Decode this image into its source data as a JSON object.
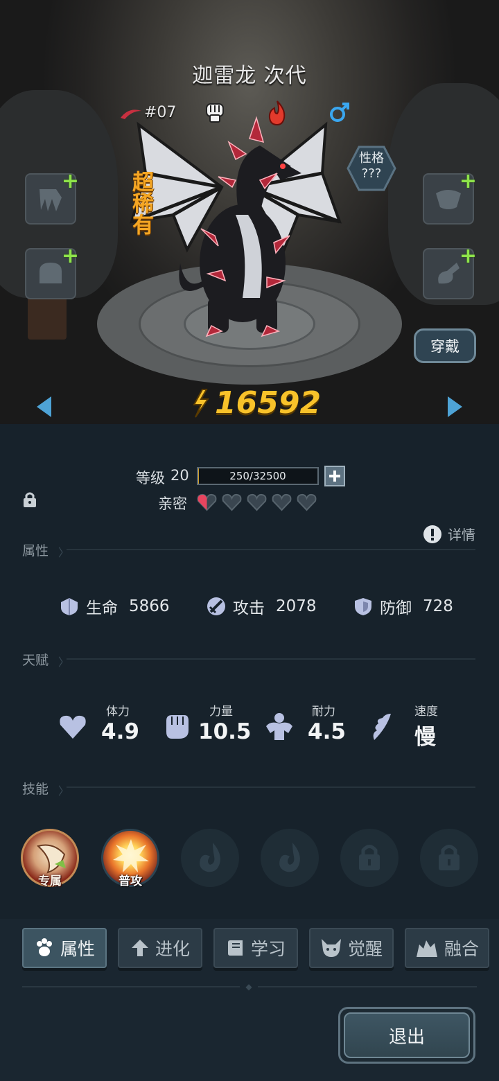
{
  "pet": {
    "name": "迦雷龙 次代",
    "number": "#07",
    "rarity": "超稀有",
    "personality_label": "性格",
    "personality_value": "???",
    "power": "16592",
    "wear_button": "穿戴"
  },
  "level": {
    "label": "等级",
    "value": "20",
    "exp_text": "250/32500",
    "exp_progress": 0.0077
  },
  "intimacy": {
    "label": "亲密",
    "hearts_filled": 0.5,
    "hearts_total": 5
  },
  "details_label": "详情",
  "sections": {
    "attributes": "属性",
    "talents": "天赋",
    "skills": "技能"
  },
  "stats": {
    "hp_label": "生命",
    "hp_value": "5866",
    "atk_label": "攻击",
    "atk_value": "2078",
    "def_label": "防御",
    "def_value": "728"
  },
  "talents": [
    {
      "label": "体力",
      "value": "4.9",
      "icon": "heart-icon"
    },
    {
      "label": "力量",
      "value": "10.5",
      "icon": "fist-icon"
    },
    {
      "label": "耐力",
      "value": "4.5",
      "icon": "muscle-icon"
    },
    {
      "label": "速度",
      "value": "慢",
      "icon": "wing-icon"
    }
  ],
  "skills": [
    {
      "label": "专属",
      "state": "unlocked"
    },
    {
      "label": "普攻",
      "state": "unlocked"
    },
    {
      "label": "",
      "state": "empty"
    },
    {
      "label": "",
      "state": "empty"
    },
    {
      "label": "",
      "state": "locked"
    },
    {
      "label": "",
      "state": "locked"
    }
  ],
  "tabs": [
    "属性",
    "进化",
    "学习",
    "觉醒",
    "融合"
  ],
  "active_tab": "属性",
  "exit_button": "退出",
  "colors": {
    "power_gold": "#f8c22a",
    "rarity_orange": "#f5a623",
    "plus_green": "#8ee34a",
    "panel_bg": "#17222b"
  }
}
